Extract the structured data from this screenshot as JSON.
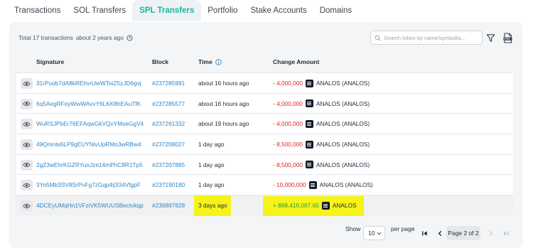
{
  "tabs": [
    {
      "label": "Transactions",
      "active": false
    },
    {
      "label": "SOL Transfers",
      "active": false
    },
    {
      "label": "SPL Transfers",
      "active": true
    },
    {
      "label": "Portfolio",
      "active": false
    },
    {
      "label": "Stake Accounts",
      "active": false
    },
    {
      "label": "Domains",
      "active": false
    }
  ],
  "summary": {
    "total": "Total 17 transactions",
    "age": "about 2 years ago",
    "icon": "clock-icon"
  },
  "search": {
    "placeholder": "Search token by name/symbol/a..."
  },
  "table": {
    "columns": {
      "signature": "Signature",
      "block": "Block",
      "time": "Time",
      "change": "Change Amount"
    },
    "rows": [
      {
        "signature": "31rPuob7dA8kREhvrUwWToiZ5zJD6gvj",
        "block": "#237285991",
        "time": "about 16 hours ago",
        "amount": "- 4,000,000",
        "token": "ANALOS (ANALOS)",
        "direction": "out"
      },
      {
        "signature": "6q5AegRFoyWwWAvvY6LKK8hEAuTfK",
        "block": "#237285577",
        "time": "about 16 hours ago",
        "amount": "- 4,000,000",
        "token": "ANALOS (ANALOS)",
        "direction": "out"
      },
      {
        "signature": "WuRSJPbEr76EFAqwGkVQvYMxeGgV4",
        "block": "#237261332",
        "time": "about 19 hours ago",
        "amount": "- 4,000,000",
        "token": "ANALOS (ANALOS)",
        "direction": "out"
      },
      {
        "signature": "49Qmnts6LP9gEUYNivUpRMo3wRBw4",
        "block": "#237208027",
        "time": "1 day ago",
        "amount": "- 8,500,000",
        "token": "ANALOS (ANALOS)",
        "direction": "out"
      },
      {
        "signature": "2gZ3wEhrKGZRYuoJze14mPhC8R1Tp5",
        "block": "#237207885",
        "time": "1 day ago",
        "amount": "- 8,500,000",
        "token": "ANALOS (ANALOS)",
        "direction": "out"
      },
      {
        "signature": "3Yo5Mb3SV8SrPvFg7zGqp4ij334VfgpF",
        "block": "#237190180",
        "time": "1 day ago",
        "amount": "- 10,000,000",
        "token": "ANALOS (ANALOS)",
        "direction": "out"
      },
      {
        "signature": "4DCEyUMqHn1VFziVK5WUUSBectvkqp",
        "block": "#236897828",
        "time": "3 days ago",
        "amount": "+ 868,416,097.65",
        "token": "ANALOS",
        "direction": "in"
      }
    ]
  },
  "pagination": {
    "show_label": "Show",
    "page_size": "10",
    "per_page_label": "per page",
    "page_label": "Page 2 of 2"
  },
  "colors": {
    "accent": "#14b8a6",
    "link": "#2f86c9",
    "negative": "#dc2626",
    "positive": "#16a34a",
    "highlight": "#f5f318"
  }
}
